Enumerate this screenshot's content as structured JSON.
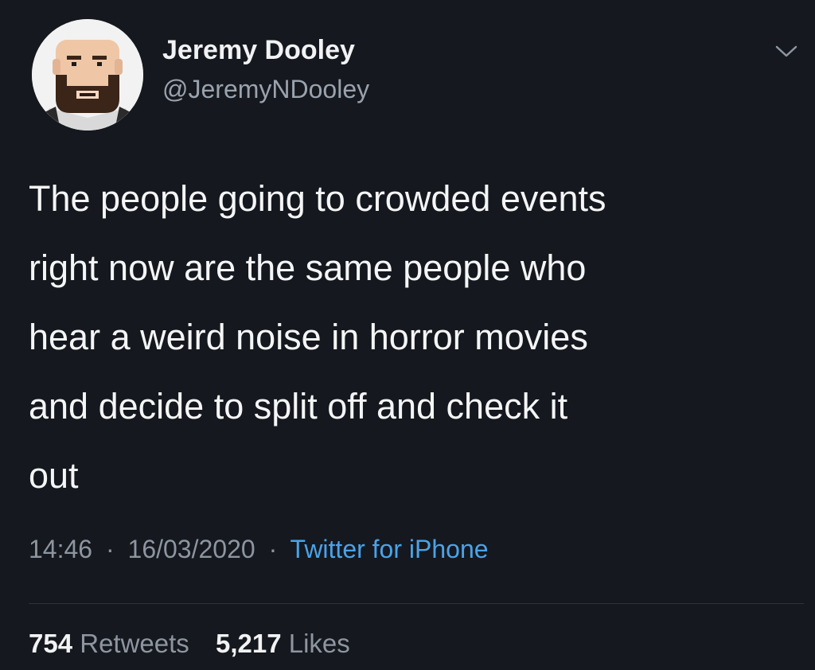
{
  "author": {
    "name": "Jeremy Dooley",
    "handle": "@JeremyNDooley",
    "avatar_icon": "bearded-man-avatar"
  },
  "tweet": {
    "lines": [
      "The people going to crowded events",
      "right now are the same people who",
      "hear a weird noise in horror movies",
      "and decide to split off and check it",
      "out"
    ],
    "time": "14:46",
    "date": "16/03/2020",
    "separator": "·",
    "source": "Twitter for iPhone"
  },
  "stats": {
    "retweets_count": "754",
    "retweets_label": "Retweets",
    "likes_count": "5,217",
    "likes_label": "Likes"
  },
  "menu_icon": "chevron-down-icon",
  "colors": {
    "background": "#15181e",
    "text": "#f4f5f6",
    "muted": "#8d96a0",
    "link": "#4aa3e8"
  }
}
